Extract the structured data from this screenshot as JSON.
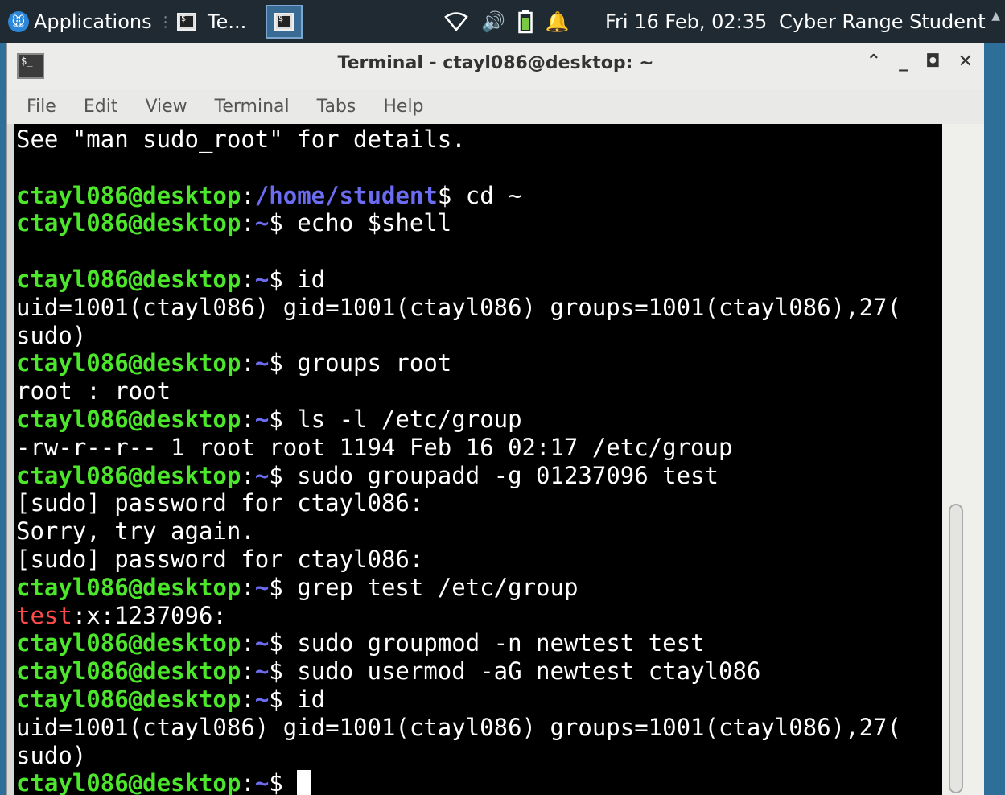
{
  "panel": {
    "applications_label": "Applications",
    "task1_label": "Te...",
    "clock": "Fri 16 Feb, 02:35",
    "user": "Cyber Range Student"
  },
  "window": {
    "title": "Terminal - ctayl086@desktop: ~",
    "menu": [
      "File",
      "Edit",
      "View",
      "Terminal",
      "Tabs",
      "Help"
    ]
  },
  "terminal": {
    "lines": [
      [
        {
          "t": "See \"man sudo_root\" for details."
        }
      ],
      [],
      [
        {
          "t": "ctayl086@desktop",
          "c": "user"
        },
        {
          "t": ":"
        },
        {
          "t": "/home/student",
          "c": "path"
        },
        {
          "t": "$ cd ~"
        }
      ],
      [
        {
          "t": "ctayl086@desktop",
          "c": "user"
        },
        {
          "t": ":"
        },
        {
          "t": "~",
          "c": "path"
        },
        {
          "t": "$ echo $shell"
        }
      ],
      [],
      [
        {
          "t": "ctayl086@desktop",
          "c": "user"
        },
        {
          "t": ":"
        },
        {
          "t": "~",
          "c": "path"
        },
        {
          "t": "$ id"
        }
      ],
      [
        {
          "t": "uid=1001(ctayl086) gid=1001(ctayl086) groups=1001(ctayl086),27("
        }
      ],
      [
        {
          "t": "sudo)"
        }
      ],
      [
        {
          "t": "ctayl086@desktop",
          "c": "user"
        },
        {
          "t": ":"
        },
        {
          "t": "~",
          "c": "path"
        },
        {
          "t": "$ groups root"
        }
      ],
      [
        {
          "t": "root : root"
        }
      ],
      [
        {
          "t": "ctayl086@desktop",
          "c": "user"
        },
        {
          "t": ":"
        },
        {
          "t": "~",
          "c": "path"
        },
        {
          "t": "$ ls -l /etc/group"
        }
      ],
      [
        {
          "t": "-rw-r--r-- 1 root root 1194 Feb 16 02:17 /etc/group"
        }
      ],
      [
        {
          "t": "ctayl086@desktop",
          "c": "user"
        },
        {
          "t": ":"
        },
        {
          "t": "~",
          "c": "path"
        },
        {
          "t": "$ sudo groupadd -g 01237096 test"
        }
      ],
      [
        {
          "t": "[sudo] password for ctayl086:"
        }
      ],
      [
        {
          "t": "Sorry, try again."
        }
      ],
      [
        {
          "t": "[sudo] password for ctayl086:"
        }
      ],
      [
        {
          "t": "ctayl086@desktop",
          "c": "user"
        },
        {
          "t": ":"
        },
        {
          "t": "~",
          "c": "path"
        },
        {
          "t": "$ grep test /etc/group"
        }
      ],
      [
        {
          "t": "test",
          "c": "err"
        },
        {
          "t": ":x:1237096:"
        }
      ],
      [
        {
          "t": "ctayl086@desktop",
          "c": "user"
        },
        {
          "t": ":"
        },
        {
          "t": "~",
          "c": "path"
        },
        {
          "t": "$ sudo groupmod -n newtest test"
        }
      ],
      [
        {
          "t": "ctayl086@desktop",
          "c": "user"
        },
        {
          "t": ":"
        },
        {
          "t": "~",
          "c": "path"
        },
        {
          "t": "$ sudo usermod -aG newtest ctayl086"
        }
      ],
      [
        {
          "t": "ctayl086@desktop",
          "c": "user"
        },
        {
          "t": ":"
        },
        {
          "t": "~",
          "c": "path"
        },
        {
          "t": "$ id"
        }
      ],
      [
        {
          "t": "uid=1001(ctayl086) gid=1001(ctayl086) groups=1001(ctayl086),27("
        }
      ],
      [
        {
          "t": "sudo)"
        }
      ],
      [
        {
          "t": "ctayl086@desktop",
          "c": "user"
        },
        {
          "t": ":"
        },
        {
          "t": "~",
          "c": "path"
        },
        {
          "t": "$ "
        },
        {
          "cursor": true
        }
      ]
    ]
  }
}
